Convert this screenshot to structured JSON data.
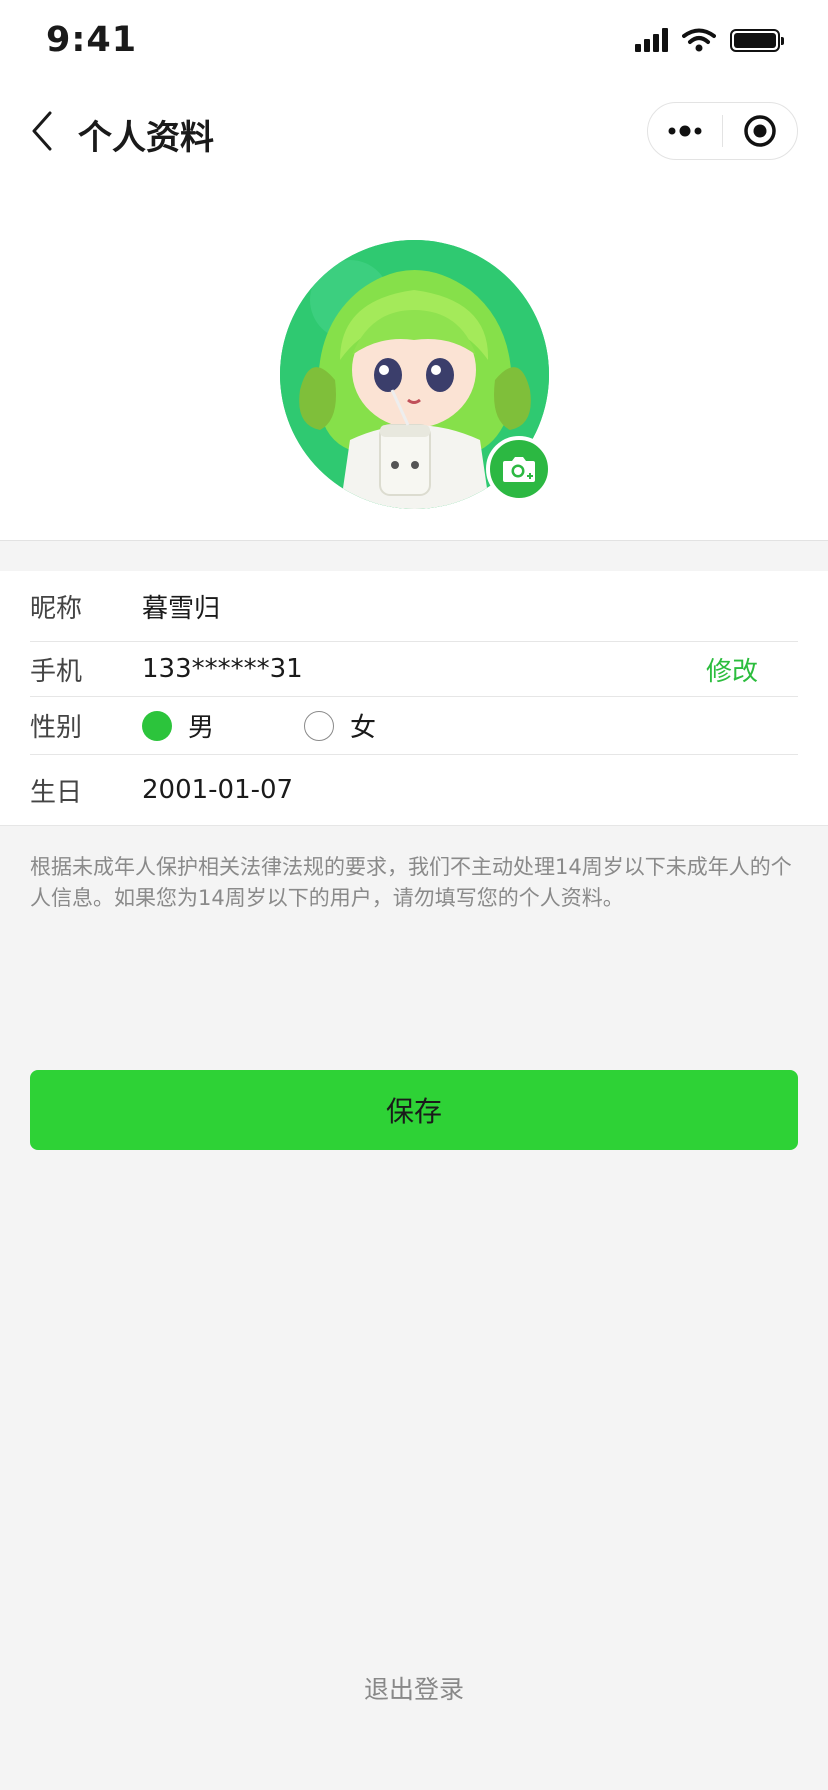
{
  "status_bar": {
    "time": "9:41"
  },
  "nav": {
    "title": "个人资料"
  },
  "form": {
    "nickname": {
      "label": "昵称",
      "value": "暮雪归"
    },
    "phone": {
      "label": "手机",
      "value": "133******31",
      "action": "修改"
    },
    "gender": {
      "label": "性别",
      "options": [
        "男",
        "女"
      ],
      "selected": "男"
    },
    "birthday": {
      "label": "生日",
      "value": "2001-01-07"
    }
  },
  "notice": "根据未成年人保护相关法律法规的要求，我们不主动处理14周岁以下未成年人的个人信息。如果您为14周岁以下的用户，请勿填写您的个人资料。",
  "buttons": {
    "save": "保存",
    "logout": "退出登录"
  },
  "colors": {
    "accent": "#2ed236",
    "link": "#2cbd3e",
    "avatar_bg": "#2fc971"
  },
  "icons": [
    "back-icon",
    "more-icon",
    "record-icon",
    "camera-icon",
    "signal-icon",
    "wifi-icon",
    "battery-icon"
  ]
}
